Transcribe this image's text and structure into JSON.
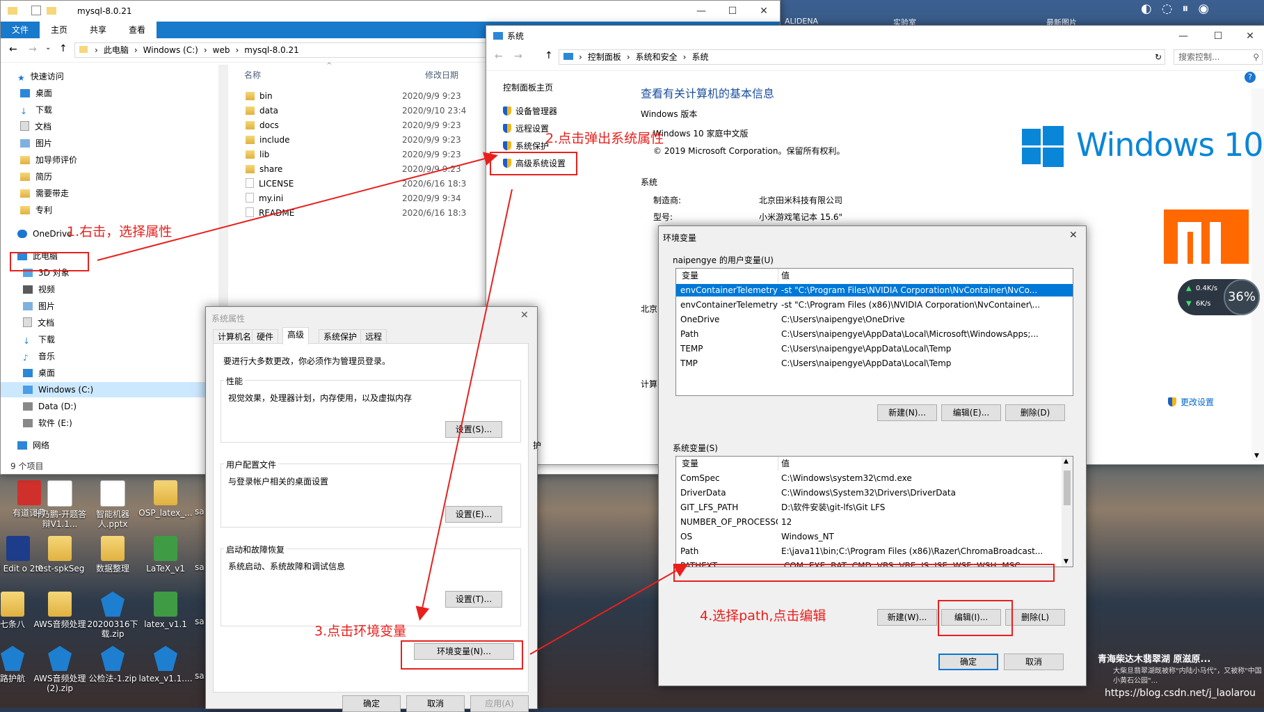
{
  "explorer": {
    "title": "mysql-8.0.21",
    "ribbon": [
      "文件",
      "主页",
      "共享",
      "查看"
    ],
    "breadcrumb": [
      "此电脑",
      "Windows (C:)",
      "web",
      "mysql-8.0.21"
    ],
    "col_name": "名称",
    "col_date": "修改日期",
    "sidebar": [
      "快速访问",
      "桌面",
      "下载",
      "文档",
      "图片",
      "加导师评价",
      "简历",
      "需要带走",
      "专利",
      "OneDrive",
      "此电脑",
      "3D 对象",
      "视频",
      "图片",
      "文档",
      "下载",
      "音乐",
      "桌面",
      "Windows (C:)",
      "Data (D:)",
      "软件 (E:)",
      "网络"
    ],
    "files": [
      {
        "name": "bin",
        "date": "2020/9/9 9:23"
      },
      {
        "name": "data",
        "date": "2020/9/10 23:4"
      },
      {
        "name": "docs",
        "date": "2020/9/9 9:23"
      },
      {
        "name": "include",
        "date": "2020/9/9 9:23"
      },
      {
        "name": "lib",
        "date": "2020/9/9 9:23"
      },
      {
        "name": "share",
        "date": "2020/9/9 9:23"
      },
      {
        "name": "LICENSE",
        "date": "2020/6/16 18:3"
      },
      {
        "name": "my.ini",
        "date": "2020/9/9 9:34"
      },
      {
        "name": "README",
        "date": "2020/6/16 18:3"
      }
    ],
    "status": "9 个项目"
  },
  "control_panel": {
    "title": "系统",
    "breadcrumb": [
      "控制面板",
      "系统和安全",
      "系统"
    ],
    "search_placeholder": "搜索控制...",
    "home_link": "控制面板主页",
    "left_links": [
      "设备管理器",
      "远程设置",
      "系统保护",
      "高级系统设置"
    ],
    "heading": "查看有关计算机的基本信息",
    "edition_label": "Windows 版本",
    "edition": "Windows 10 家庭中文版",
    "copyright": "© 2019 Microsoft Corporation。保留所有权利。",
    "logo_text": "Windows 10",
    "system_label": "系统",
    "manufacturer_key": "制造商:",
    "manufacturer_val": "北京田米科技有限公司",
    "model_key": "型号:",
    "model_val": "小米游戏笔记本 15.6\"",
    "partial_1": "北京",
    "partial_2": "计算",
    "change_settings": "更改设置",
    "net_up": "0.4K/s",
    "net_down": "6K/s",
    "net_pct": "36%"
  },
  "sysprop": {
    "title": "系统属性",
    "tabs": [
      "计算机名",
      "硬件",
      "高级",
      "系统保护",
      "远程"
    ],
    "admin_note": "要进行大多数更改，你必须作为管理员登录。",
    "perf_label": "性能",
    "perf_desc": "视觉效果，处理器计划，内存使用，以及虚拟内存",
    "perf_btn": "设置(S)...",
    "profile_label": "用户配置文件",
    "profile_desc": "与登录帐户相关的桌面设置",
    "profile_btn": "设置(E)...",
    "startup_label": "启动和故障恢复",
    "startup_desc": "系统启动、系统故障和调试信息",
    "startup_btn": "设置(T)...",
    "env_btn": "环境变量(N)...",
    "ok": "确定",
    "cancel": "取消",
    "apply": "应用(A)",
    "partial": "护"
  },
  "envvars": {
    "title": "环境变量",
    "user_label": "naipengye 的用户变量(U)",
    "col_var": "变量",
    "col_val": "值",
    "user_vars": [
      {
        "name": "envContainerTelemetryAp...",
        "value": "-st \"C:\\Program Files\\NVIDIA Corporation\\NvContainer\\NvCo..."
      },
      {
        "name": "envContainerTelemetryAp...",
        "value": "-st \"C:\\Program Files (x86)\\NVIDIA Corporation\\NvContainer\\..."
      },
      {
        "name": "OneDrive",
        "value": "C:\\Users\\naipengye\\OneDrive"
      },
      {
        "name": "Path",
        "value": "C:\\Users\\naipengye\\AppData\\Local\\Microsoft\\WindowsApps;..."
      },
      {
        "name": "TEMP",
        "value": "C:\\Users\\naipengye\\AppData\\Local\\Temp"
      },
      {
        "name": "TMP",
        "value": "C:\\Users\\naipengye\\AppData\\Local\\Temp"
      }
    ],
    "user_new": "新建(N)...",
    "user_edit": "编辑(E)...",
    "user_delete": "删除(D)",
    "sys_label": "系统变量(S)",
    "sys_vars": [
      {
        "name": "ComSpec",
        "value": "C:\\Windows\\system32\\cmd.exe"
      },
      {
        "name": "DriverData",
        "value": "C:\\Windows\\System32\\Drivers\\DriverData"
      },
      {
        "name": "GIT_LFS_PATH",
        "value": "D:\\软件安装\\git-lfs\\Git LFS"
      },
      {
        "name": "NUMBER_OF_PROCESSORS",
        "value": "12"
      },
      {
        "name": "OS",
        "value": "Windows_NT"
      },
      {
        "name": "Path",
        "value": "E:\\java11\\bin;C:\\Program Files (x86)\\Razer\\ChromaBroadcast..."
      },
      {
        "name": "PATHEXT",
        "value": ".COM;.EXE;.BAT;.CMD;.VBS;.VBE;.JS;.JSE;.WSF;.WSH;.MSC"
      }
    ],
    "sys_new": "新建(W)...",
    "sys_edit": "编辑(I)...",
    "sys_delete": "删除(L)",
    "ok": "确定",
    "cancel": "取消"
  },
  "desktop": {
    "icons": [
      {
        "label": "有道词典"
      },
      {
        "label": "叶乃鹏-开题答辩V1.1..."
      },
      {
        "label": "智能机器人.pptx"
      },
      {
        "label": "OSP_latex_..."
      },
      {
        "label": "ol Edit o 2.0"
      },
      {
        "label": "test-spkSeg"
      },
      {
        "label": "数据整理"
      },
      {
        "label": "LaTeX_v1"
      },
      {
        "label": "七条八"
      },
      {
        "label": "AWS音频处理"
      },
      {
        "label": "20200316下载.zip"
      },
      {
        "label": "latex_v1.1"
      },
      {
        "label": "路护航"
      },
      {
        "label": "AWS音频处理 (2).zip"
      },
      {
        "label": "公检法-1.zip"
      },
      {
        "label": "latex_v1.1...."
      }
    ],
    "top_icons": [
      "ALIDENA",
      "实验室",
      "最新图片"
    ],
    "sa_labels": [
      "sa",
      "sa",
      "sa",
      "sa"
    ],
    "wallpaper_caption": "青海柴达木翡翠湖 原滋原...",
    "wallpaper_sub": "大柴旦翡翠湖既被称\"内陆小马代\"，又被称\"中国小黄石公园\"...",
    "watermark": "https://blog.csdn.net/j_laolarou"
  },
  "annotations": {
    "step1": "1.右击，选择属性",
    "step2": "2.点击弹出系统属性",
    "step3": "3.点击环境变量",
    "step4": "4.选择path,点击编辑"
  },
  "colors": {
    "accent": "#0078d7",
    "annotation": "#e8201d",
    "ribbon": "#1979ca",
    "link": "#0066cc"
  }
}
